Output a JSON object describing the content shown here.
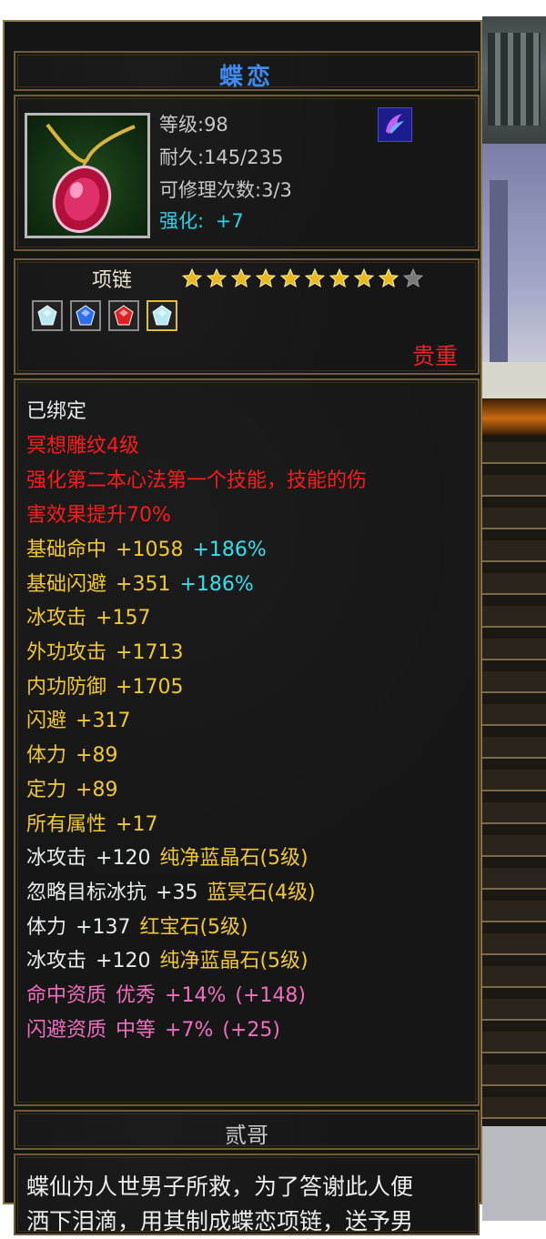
{
  "item": {
    "name": "蝶恋",
    "level": "等级:98",
    "durability": "耐久:145/235",
    "repairs": "可修理次数:3/3",
    "enhance_label": "强化:",
    "enhance_value": "+7",
    "icon": "pink-gem-necklace-icon",
    "skill_icon": "purple-wing-skill-icon",
    "type": "项链",
    "stars_total": 10,
    "stars_filled": 9,
    "gems": [
      {
        "icon": "white-crystal-gem-icon",
        "color": "#b8e8f0"
      },
      {
        "icon": "blue-crystal-gem-icon",
        "color": "#2c6ef0"
      },
      {
        "icon": "red-ruby-gem-icon",
        "color": "#e02020"
      },
      {
        "icon": "white-crystal-gem-icon",
        "color": "#b8e8f0"
      }
    ],
    "rarity": "贵重"
  },
  "desc": {
    "bound": "已绑定",
    "engraving": "冥想雕纹4级",
    "effect_1": "强化第二本心法第一个技能，技能的伤",
    "effect_2": "害效果提升70%",
    "attrs": [
      {
        "name": "基础命中",
        "value": "+1058",
        "bonus": "+186%"
      },
      {
        "name": "基础闪避",
        "value": "+351",
        "bonus": "+186%"
      },
      {
        "name": "冰攻击",
        "value": "+157",
        "bonus": ""
      },
      {
        "name": "外功攻击",
        "value": "+1713",
        "bonus": ""
      },
      {
        "name": "内功防御",
        "value": "+1705",
        "bonus": ""
      },
      {
        "name": "闪避",
        "value": "+317",
        "bonus": ""
      },
      {
        "name": "体力",
        "value": "+89",
        "bonus": ""
      },
      {
        "name": "定力",
        "value": "+89",
        "bonus": ""
      },
      {
        "name": "所有属性",
        "value": "+17",
        "bonus": ""
      }
    ],
    "gem_attrs": [
      {
        "name": "冰攻击",
        "value": "+120",
        "gem": "纯净蓝晶石(5级)"
      },
      {
        "name": "忽略目标冰抗",
        "value": "+35",
        "gem": "蓝冥石(4级)"
      },
      {
        "name": "体力",
        "value": "+137",
        "gem": "红宝石(5级)"
      },
      {
        "name": "冰攻击",
        "value": "+120",
        "gem": "纯净蓝晶石(5级)"
      }
    ],
    "qualities": [
      {
        "name": "命中资质",
        "grade": "优秀",
        "value": "+14%",
        "extra": "(+148)"
      },
      {
        "name": "闪避资质",
        "grade": "中等",
        "value": "+7%",
        "extra": "(+25)"
      }
    ]
  },
  "owner": "贰哥",
  "lore": "蝶仙为人世男子所救，为了答谢此人便\n洒下泪滴，用其制成蝶恋项链，送予男",
  "colors": {
    "white": "#e8ecec",
    "red": "#ff1a1a",
    "yellow": "#f2c830",
    "cyan": "#33e0f0",
    "pink": "#f06ec0",
    "title": "#3f8cf0",
    "frame": "#8c7440"
  }
}
